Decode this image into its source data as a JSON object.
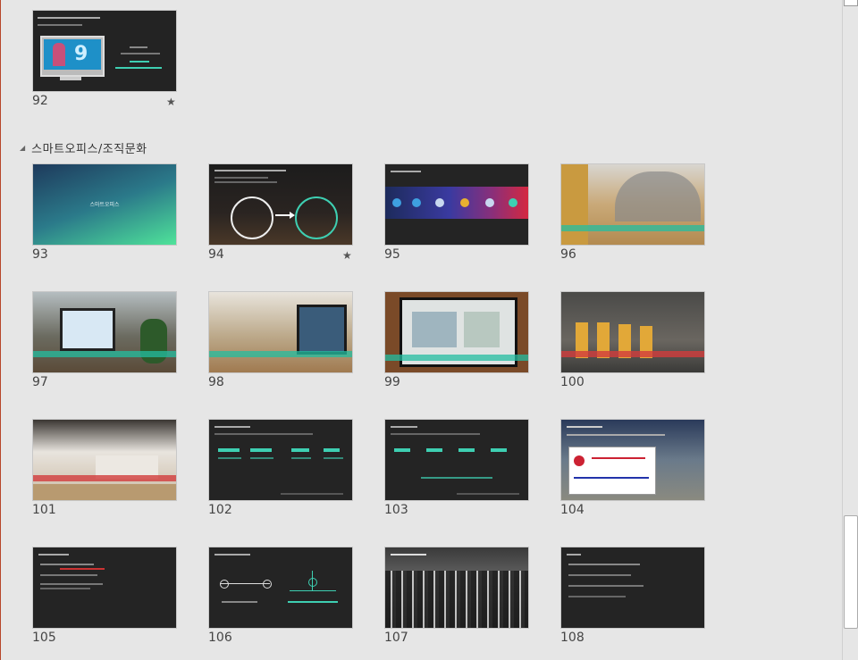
{
  "section": {
    "title": "스마트오피스/조직문화"
  },
  "slides": [
    {
      "number": "92",
      "starred": true
    },
    {
      "number": "93",
      "title": "스마트오피스"
    },
    {
      "number": "94",
      "starred": true
    },
    {
      "number": "95"
    },
    {
      "number": "96"
    },
    {
      "number": "97"
    },
    {
      "number": "98"
    },
    {
      "number": "99"
    },
    {
      "number": "100"
    },
    {
      "number": "101"
    },
    {
      "number": "102"
    },
    {
      "number": "103"
    },
    {
      "number": "104"
    },
    {
      "number": "105"
    },
    {
      "number": "106"
    },
    {
      "number": "107"
    },
    {
      "number": "108"
    }
  ],
  "star_glyph": "★",
  "colors": {
    "accent_frame": "#b7472a",
    "teal": "#3ecfb2",
    "background": "#e6e6e6"
  }
}
